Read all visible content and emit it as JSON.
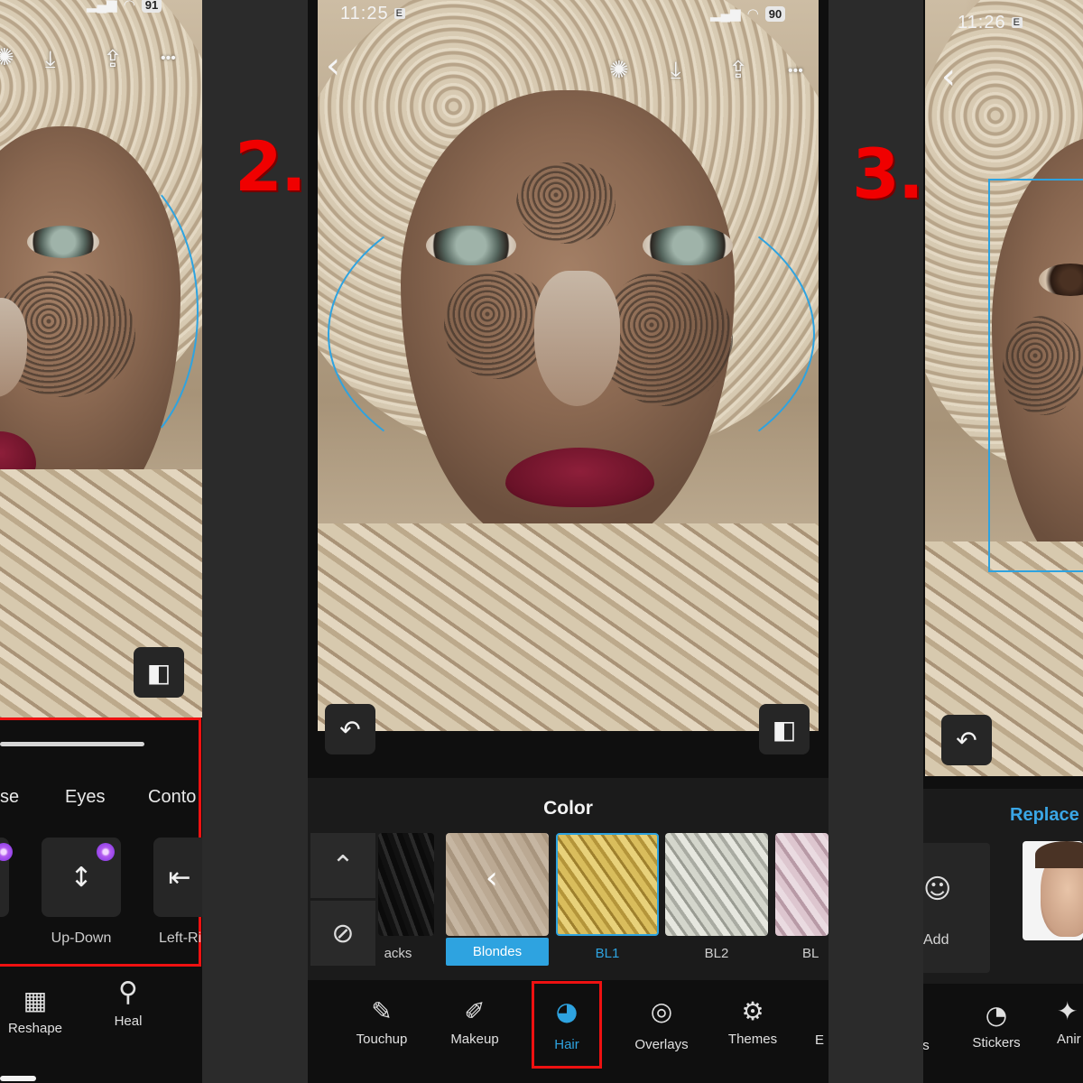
{
  "steps": {
    "two": "2.",
    "three": "3."
  },
  "panel1": {
    "status": {
      "battery": "91"
    },
    "icons": [
      "bulb-icon",
      "download-icon",
      "share-icon",
      "more-icon"
    ],
    "more_glyph": "•••",
    "categories": [
      "se",
      "Eyes",
      "Conto"
    ],
    "tools": [
      {
        "label": "Up-Down",
        "icon": "up-down-arrows-icon",
        "premium": true
      },
      {
        "label": "Left-Ri",
        "icon": "left-right-arrows-icon",
        "premium": false
      }
    ],
    "nav": [
      {
        "label": "Reshape",
        "icon": "grid-icon"
      },
      {
        "label": "Heal",
        "icon": "magic-wand-icon"
      }
    ],
    "compare_glyph": "◧"
  },
  "panel2": {
    "status": {
      "time": "11:25",
      "sim": "E",
      "battery": "90"
    },
    "back_glyph": "‹",
    "icons": [
      "bulb-icon",
      "download-icon",
      "share-icon",
      "more-icon"
    ],
    "more_glyph": "•••",
    "undo_glyph": "↶",
    "compare_glyph": "◧",
    "sheet_title": "Color",
    "side_buttons": [
      {
        "name": "collapse-icon",
        "glyph": "⌃"
      },
      {
        "name": "none-icon",
        "glyph": "⊘"
      }
    ],
    "swatches": [
      {
        "label": "acks",
        "color": "#1c1c1c",
        "state": "partial"
      },
      {
        "label": "Blondes",
        "color": "#b8a692",
        "state": "group-active"
      },
      {
        "label": "BL1",
        "color": "#cfb45a",
        "state": "selected"
      },
      {
        "label": "BL2",
        "color": "#c9cbc2",
        "state": "normal"
      },
      {
        "label": "BL",
        "color": "#d3b9c4",
        "state": "partial"
      }
    ],
    "nav": [
      {
        "label": "Touchup",
        "icon": "brush-icon",
        "glyph": "✎"
      },
      {
        "label": "Makeup",
        "icon": "makeup-brush-icon",
        "glyph": "✐"
      },
      {
        "label": "Hair",
        "icon": "hair-icon",
        "glyph": "◕",
        "active": true
      },
      {
        "label": "Overlays",
        "icon": "overlays-icon",
        "glyph": "◎"
      },
      {
        "label": "Themes",
        "icon": "themes-icon",
        "glyph": "⚙"
      },
      {
        "label": "E",
        "icon": "more-nav-icon",
        "glyph": ""
      }
    ],
    "colors": {
      "accent": "#2ea3e0",
      "highlight": "#e11111"
    }
  },
  "panel3": {
    "status": {
      "time": "11:26",
      "sim": "E"
    },
    "back_glyph": "‹",
    "undo_glyph": "↶",
    "sheet_title": "Replace F",
    "add_label": "Add",
    "add_glyph": "☺",
    "nav": [
      {
        "label": "s",
        "icon": ""
      },
      {
        "label": "Stickers",
        "icon": "stickers-icon",
        "glyph": "◔"
      },
      {
        "label": "Anir",
        "icon": "animation-icon",
        "glyph": "✦"
      }
    ]
  }
}
